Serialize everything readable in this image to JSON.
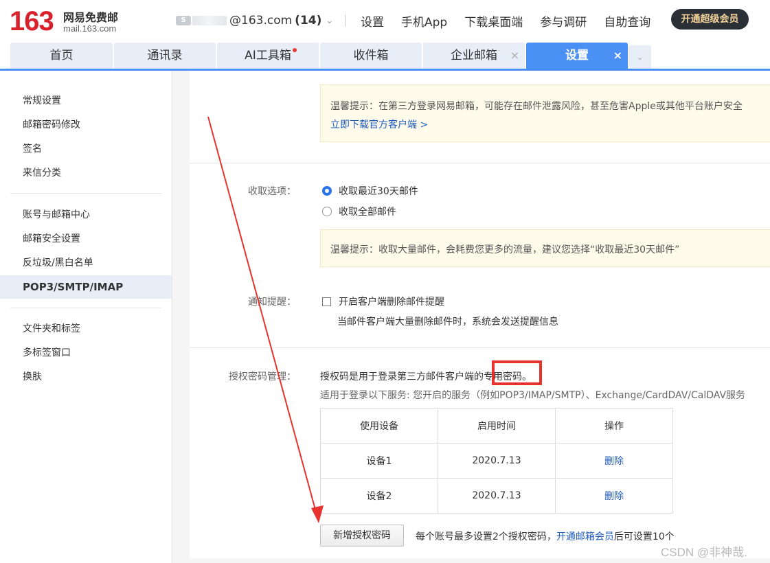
{
  "header": {
    "logo_num": "163",
    "logo_cn": "网易免费邮",
    "logo_domain": "mail.163.com",
    "account_domain": "@163.com",
    "account_count": "(14)",
    "links": [
      "设置",
      "手机App",
      "下载桌面端",
      "参与调研",
      "自助查询"
    ],
    "vip_label": "开通超级会员"
  },
  "tabs": [
    {
      "label": "首页"
    },
    {
      "label": "通讯录"
    },
    {
      "label": "AI工具箱",
      "has_dot": true
    },
    {
      "label": "收件箱"
    },
    {
      "label": "企业邮箱",
      "closable": true
    },
    {
      "label": "设置",
      "closable": true,
      "active": true
    }
  ],
  "sidebar": {
    "items": [
      "常规设置",
      "邮箱密码修改",
      "签名",
      "来信分类",
      "账号与邮箱中心",
      "邮箱安全设置",
      "反垃圾/黑白名单",
      "POP3/SMTP/IMAP",
      "文件夹和标签",
      "多标签窗口",
      "换肤"
    ],
    "active": "POP3/SMTP/IMAP"
  },
  "main": {
    "tip1_text": "温馨提示：在第三方登录网易邮箱，可能存在邮件泄露风险，甚至危害Apple或其他平台账户安全",
    "tip1_link": "立即下载官方客户端 >",
    "fetch_label": "收取选项：",
    "fetch_opt1": "收取最近30天邮件",
    "fetch_opt2": "收取全部邮件",
    "fetch_selected": "收取最近30天邮件",
    "tip2_text": "温馨提示：收取大量邮件，会耗费您更多的流量，建议您选择“收取最近30天邮件”",
    "notify_label": "通知提醒：",
    "notify_checkbox": "开启客户端删除邮件提醒",
    "notify_checked": false,
    "notify_desc": "当邮件客户端大量删除邮件时，系统会发送提醒信息",
    "auth_label": "授权密码管理：",
    "auth_desc": "授权码是用于登录第三方邮件客户端的专用密码。",
    "auth_services": "适用于登录以下服务: 您开启的服务（例如POP3/IMAP/SMTP）、Exchange/CardDAV/CalDAV服务",
    "table": {
      "headers": [
        "使用设备",
        "启用时间",
        "操作"
      ],
      "rows": [
        [
          "设备1",
          "2020.7.13",
          "删除"
        ],
        [
          "设备2",
          "2020.7.13",
          "删除"
        ]
      ]
    },
    "add_button": "新增授权密码",
    "add_note_prefix": "每个账号最多设置2个授权密码，",
    "add_note_link": "开通邮箱会员",
    "add_note_suffix": "后可设置10个"
  },
  "watermark": "CSDN @非神哉.",
  "colors": {
    "brand_red": "#d9202d",
    "tab_active": "#4a90f5",
    "link": "#1e5bbf",
    "annotation_red": "#e8322d"
  }
}
